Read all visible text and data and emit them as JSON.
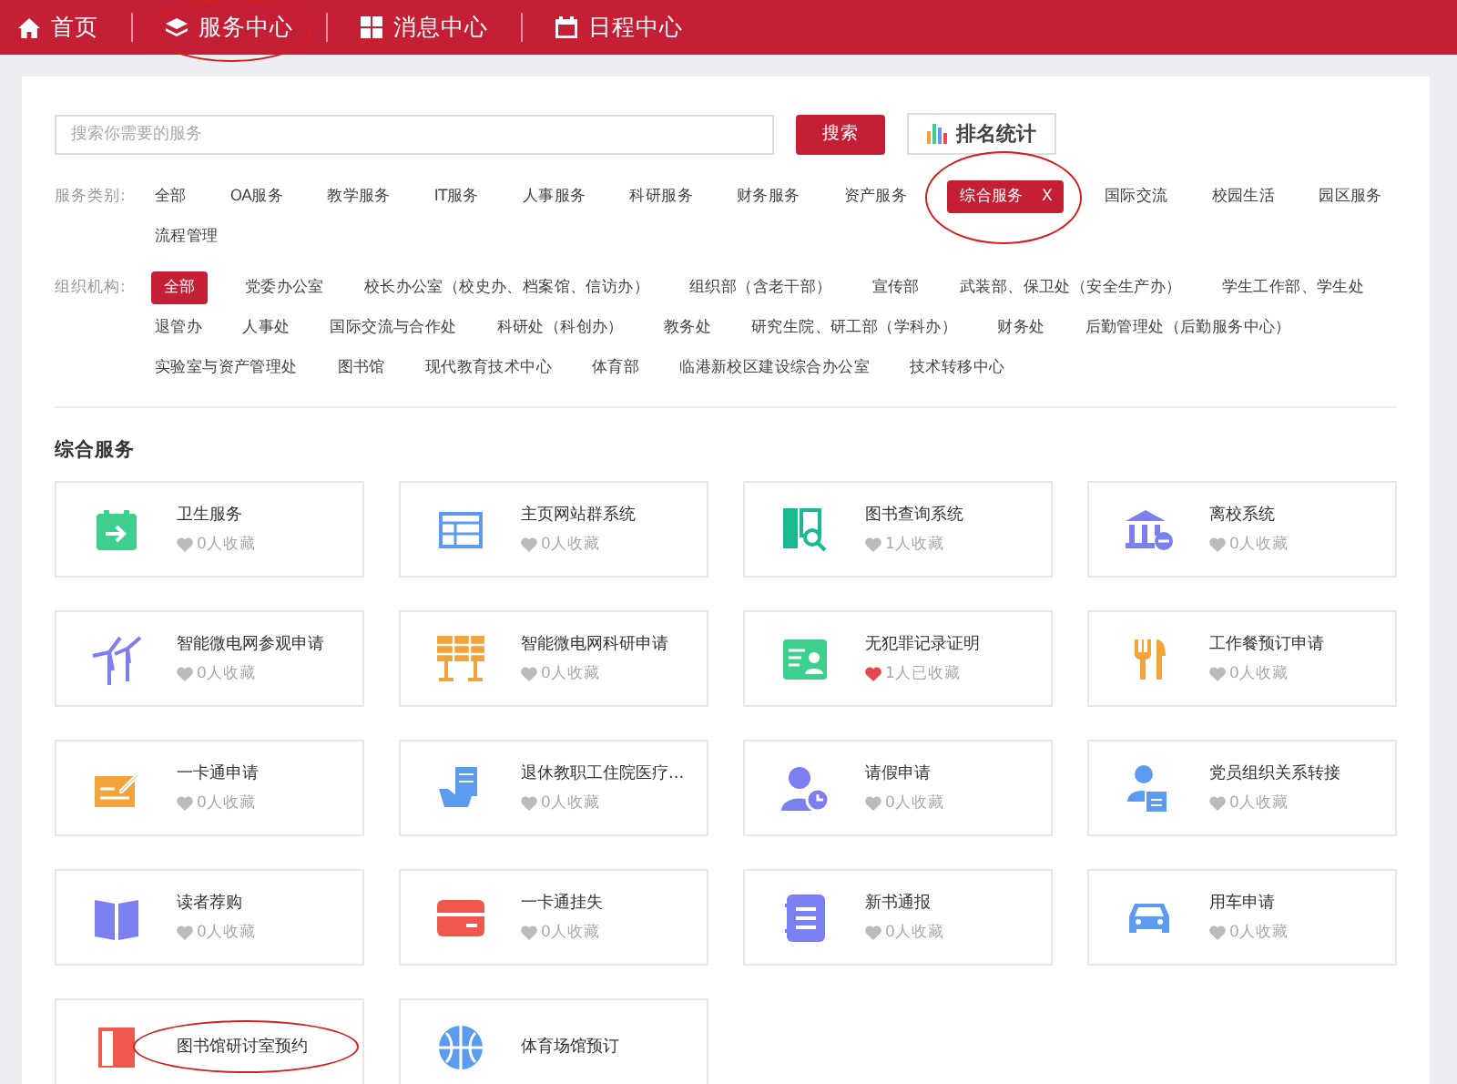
{
  "nav": {
    "items": [
      {
        "label": "首页"
      },
      {
        "label": "服务中心",
        "circled": true
      },
      {
        "label": "消息中心"
      },
      {
        "label": "日程中心"
      }
    ]
  },
  "search": {
    "placeholder": "搜索你需要的服务",
    "button": "搜索",
    "ranking_button": "排名统计"
  },
  "filters": {
    "category_label": "服务类别:",
    "clear": "X",
    "categories": [
      {
        "label": "全部",
        "selected": false,
        "circled": false
      },
      {
        "label": "OA服务",
        "selected": false,
        "circled": false
      },
      {
        "label": "教学服务",
        "selected": false,
        "circled": false
      },
      {
        "label": "IT服务",
        "selected": false,
        "circled": false
      },
      {
        "label": "人事服务",
        "selected": false,
        "circled": false
      },
      {
        "label": "科研服务",
        "selected": false,
        "circled": false
      },
      {
        "label": "财务服务",
        "selected": false,
        "circled": false
      },
      {
        "label": "资产服务",
        "selected": false,
        "circled": false
      },
      {
        "label": "综合服务",
        "selected": true,
        "circled": true
      },
      {
        "label": "国际交流",
        "selected": false,
        "circled": false
      },
      {
        "label": "校园生活",
        "selected": false,
        "circled": false
      },
      {
        "label": "园区服务",
        "selected": false,
        "circled": false
      },
      {
        "label": "流程管理",
        "selected": false,
        "circled": false
      }
    ],
    "org_label": "组织机构:",
    "orgs": [
      {
        "label": "全部",
        "selected": true
      },
      {
        "label": "党委办公室",
        "selected": false
      },
      {
        "label": "校长办公室（校史办、档案馆、信访办）",
        "selected": false
      },
      {
        "label": "组织部（含老干部）",
        "selected": false
      },
      {
        "label": "宣传部",
        "selected": false
      },
      {
        "label": "武装部、保卫处（安全生产办）",
        "selected": false
      },
      {
        "label": "学生工作部、学生处",
        "selected": false
      },
      {
        "label": "退管办",
        "selected": false
      },
      {
        "label": "人事处",
        "selected": false
      },
      {
        "label": "国际交流与合作处",
        "selected": false
      },
      {
        "label": "科研处（科创办）",
        "selected": false
      },
      {
        "label": "教务处",
        "selected": false
      },
      {
        "label": "研究生院、研工部（学科办）",
        "selected": false
      },
      {
        "label": "财务处",
        "selected": false
      },
      {
        "label": "后勤管理处（后勤服务中心）",
        "selected": false
      },
      {
        "label": "实验室与资产管理处",
        "selected": false
      },
      {
        "label": "图书馆",
        "selected": false
      },
      {
        "label": "现代教育技术中心",
        "selected": false
      },
      {
        "label": "体育部",
        "selected": false
      },
      {
        "label": "临港新校区建设综合办公室",
        "selected": false
      },
      {
        "label": "技术转移中心",
        "selected": false
      }
    ]
  },
  "section": {
    "title": "综合服务",
    "services": [
      {
        "name": "卫生服务",
        "favorites": "0人收藏",
        "favorited": false,
        "circled": false
      },
      {
        "name": "主页网站群系统",
        "favorites": "0人收藏",
        "favorited": false,
        "circled": false
      },
      {
        "name": "图书查询系统",
        "favorites": "1人收藏",
        "favorited": false,
        "circled": false
      },
      {
        "name": "离校系统",
        "favorites": "0人收藏",
        "favorited": false,
        "circled": false
      },
      {
        "name": "智能微电网参观申请",
        "favorites": "0人收藏",
        "favorited": false,
        "circled": false
      },
      {
        "name": "智能微电网科研申请",
        "favorites": "0人收藏",
        "favorited": false,
        "circled": false
      },
      {
        "name": "无犯罪记录证明",
        "favorites": "1人已收藏",
        "favorited": true,
        "circled": false
      },
      {
        "name": "工作餐预订申请",
        "favorites": "0人收藏",
        "favorited": false,
        "circled": false
      },
      {
        "name": "一卡通申请",
        "favorites": "0人收藏",
        "favorited": false,
        "circled": false
      },
      {
        "name": "退休教职工住院医疗...",
        "favorites": "0人收藏",
        "favorited": false,
        "circled": false
      },
      {
        "name": "请假申请",
        "favorites": "0人收藏",
        "favorited": false,
        "circled": false
      },
      {
        "name": "党员组织关系转接",
        "favorites": "0人收藏",
        "favorited": false,
        "circled": false
      },
      {
        "name": "读者荐购",
        "favorites": "0人收藏",
        "favorited": false,
        "circled": false
      },
      {
        "name": "一卡通挂失",
        "favorites": "0人收藏",
        "favorited": false,
        "circled": false
      },
      {
        "name": "新书通报",
        "favorites": "0人收藏",
        "favorited": false,
        "circled": false
      },
      {
        "name": "用车申请",
        "favorites": "0人收藏",
        "favorited": false,
        "circled": false
      },
      {
        "name": "图书馆研讨室预约",
        "circled": true
      },
      {
        "name": "体育场馆预订",
        "circled": false
      }
    ]
  }
}
